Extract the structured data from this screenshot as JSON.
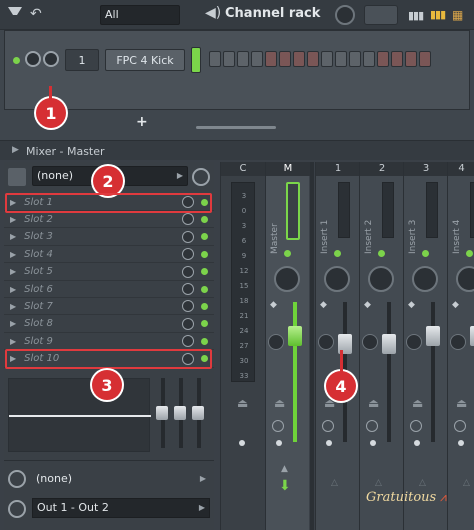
{
  "channel_rack": {
    "pattern_select": "All",
    "title": "Channel rack",
    "channel_number": "1",
    "channel_name": "FPC 4 Kick",
    "add_symbol": "+"
  },
  "mixer": {
    "title": "Mixer - Master",
    "fx_preset": "(none)",
    "slots": [
      "Slot 1",
      "Slot 2",
      "Slot 3",
      "Slot 4",
      "Slot 5",
      "Slot 6",
      "Slot 7",
      "Slot 8",
      "Slot 9",
      "Slot 10"
    ],
    "input_select": "(none)",
    "output_select": "Out 1 - Out 2",
    "strip_headers": [
      "C",
      "M",
      "1",
      "2",
      "3",
      "4"
    ],
    "strip_names": [
      "Master",
      "Insert 1",
      "Insert 2",
      "Insert 3",
      "Insert 4"
    ],
    "meter_scale": [
      "3",
      "0",
      "3",
      "6",
      "9",
      "12",
      "15",
      "18",
      "21",
      "24",
      "27",
      "30",
      "33"
    ]
  },
  "annotations": {
    "badges": [
      "1",
      "2",
      "3",
      "4"
    ],
    "watermark": "Gratuitous"
  }
}
